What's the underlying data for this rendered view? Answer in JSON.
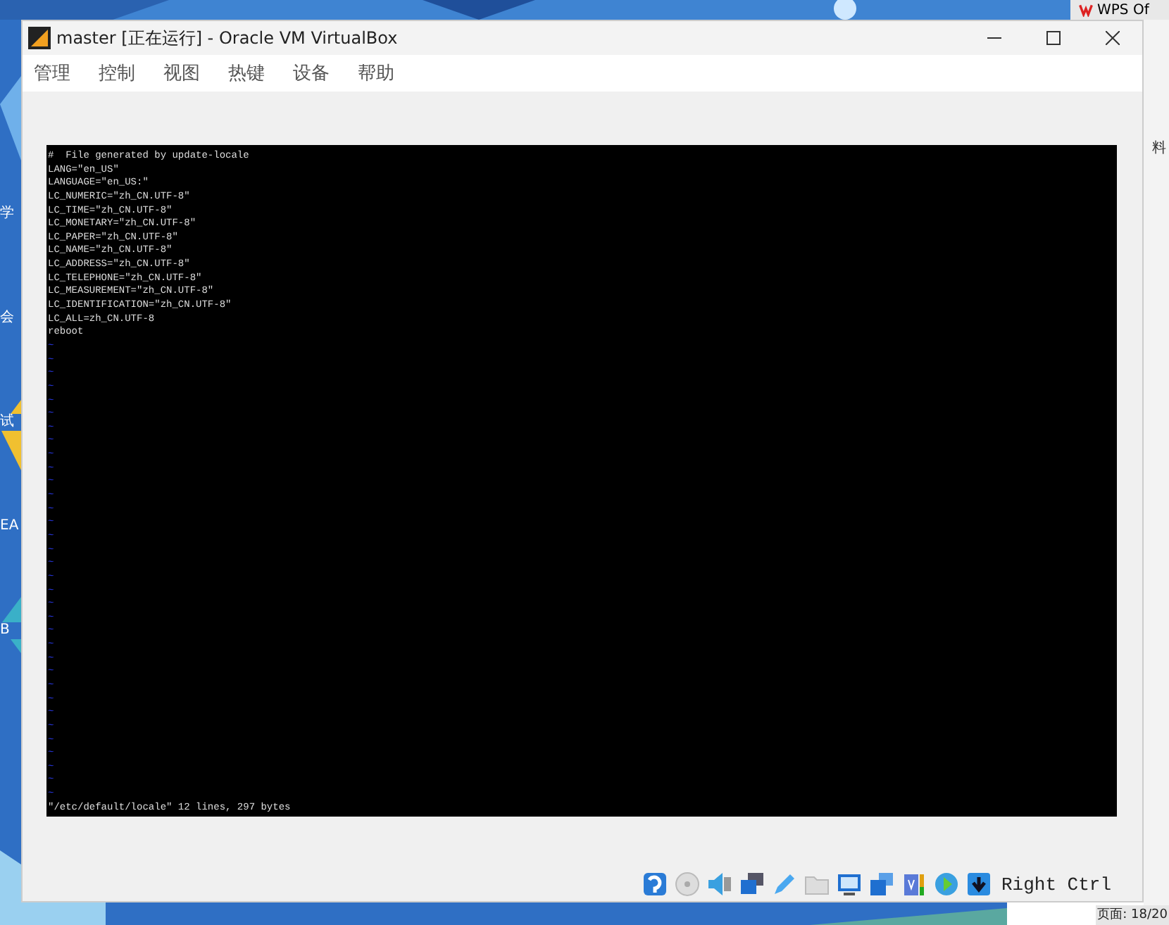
{
  "desktop": {
    "left_labels": [
      "学",
      "会",
      "试",
      "EA",
      "B"
    ],
    "background_window": {
      "tab": "WPS Of",
      "label": "料",
      "page_indicator": "页面: 18/20"
    }
  },
  "window": {
    "title": "master [正在运行] - Oracle VM VirtualBox",
    "menu": [
      "管理",
      "控制",
      "视图",
      "热键",
      "设备",
      "帮助"
    ],
    "terminal": {
      "lines": [
        "#  File generated by update-locale",
        "LANG=\"en_US\"",
        "LANGUAGE=\"en_US:\"",
        "LC_NUMERIC=\"zh_CN.UTF-8\"",
        "LC_TIME=\"zh_CN.UTF-8\"",
        "LC_MONETARY=\"zh_CN.UTF-8\"",
        "LC_PAPER=\"zh_CN.UTF-8\"",
        "LC_NAME=\"zh_CN.UTF-8\"",
        "LC_ADDRESS=\"zh_CN.UTF-8\"",
        "LC_TELEPHONE=\"zh_CN.UTF-8\"",
        "LC_MEASUREMENT=\"zh_CN.UTF-8\"",
        "LC_IDENTIFICATION=\"zh_CN.UTF-8\"",
        "LC_ALL=zh_CN.UTF-8",
        "reboot"
      ],
      "empty_lines": [
        "~",
        "~",
        "~",
        "~",
        "~",
        "~",
        "~",
        "~",
        "~",
        "~",
        "~",
        "~",
        "~",
        "~",
        "~",
        "~",
        "~",
        "~",
        "~",
        "~",
        "~",
        "~",
        "~",
        "~",
        "~",
        "~",
        "~",
        "~",
        "~",
        "~",
        "~",
        "~",
        "~",
        "~"
      ],
      "status": "\"/etc/default/locale\" 12 lines, 297 bytes"
    },
    "status_bar": {
      "host_key": "Right Ctrl"
    }
  }
}
